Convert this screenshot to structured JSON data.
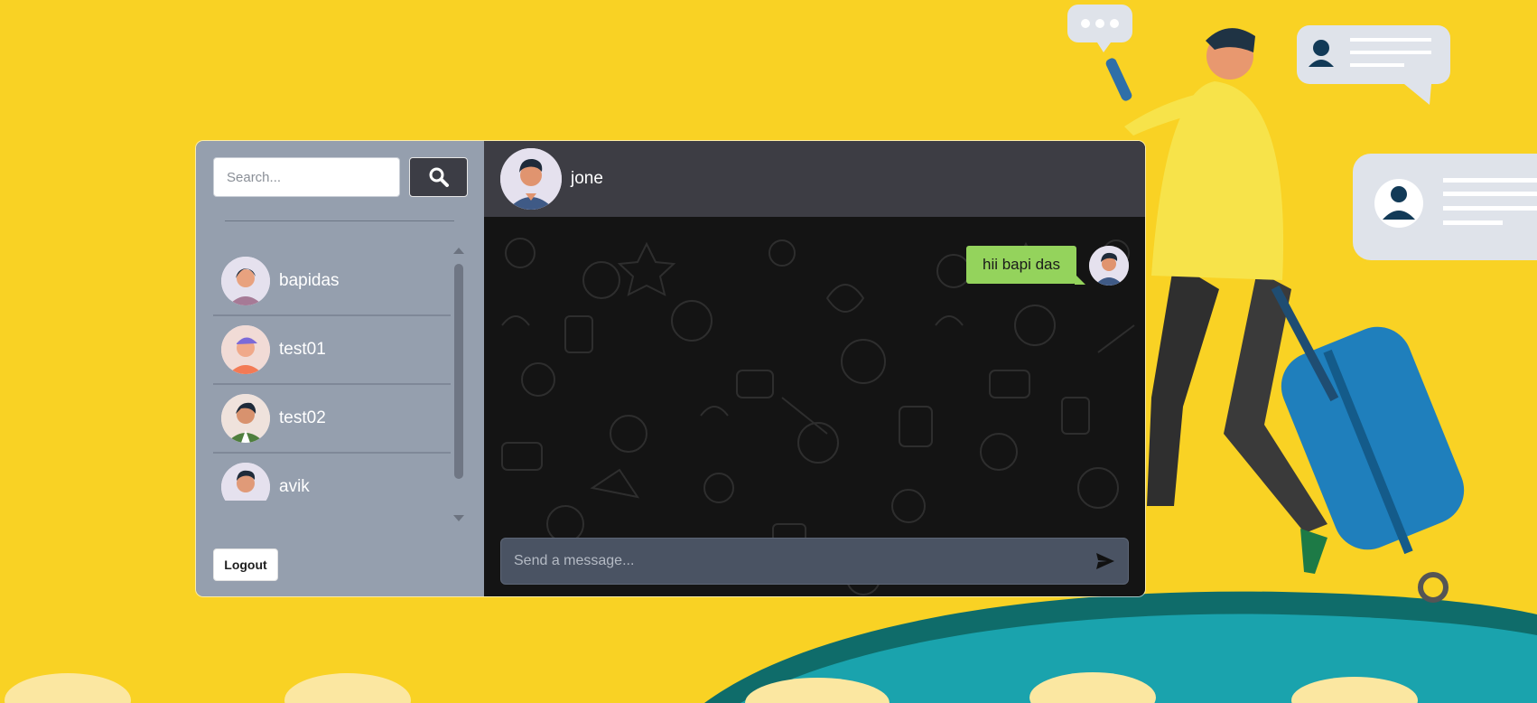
{
  "colors": {
    "background": "#f9d224",
    "sidebar": "#959fae",
    "chat_header": "#3d3d44",
    "chat_body": "#141414",
    "bubble": "#94d35c",
    "composer": "#4a5363"
  },
  "search": {
    "placeholder": "Search...",
    "button_icon": "search-icon"
  },
  "users": [
    {
      "name": "bapidas",
      "avatar": "avatar-woman-purple-shirt"
    },
    {
      "name": "test01",
      "avatar": "avatar-person-blue-cap"
    },
    {
      "name": "test02",
      "avatar": "avatar-man-green-jacket"
    },
    {
      "name": "avik",
      "avatar": "avatar-man-blue-shirt"
    }
  ],
  "sidebar": {
    "logout_label": "Logout"
  },
  "chat": {
    "contact_name": "jone",
    "messages": [
      {
        "text": "hii bapi das",
        "from": "self"
      }
    ],
    "composer_placeholder": "Send a message...",
    "send_icon": "send-icon"
  }
}
